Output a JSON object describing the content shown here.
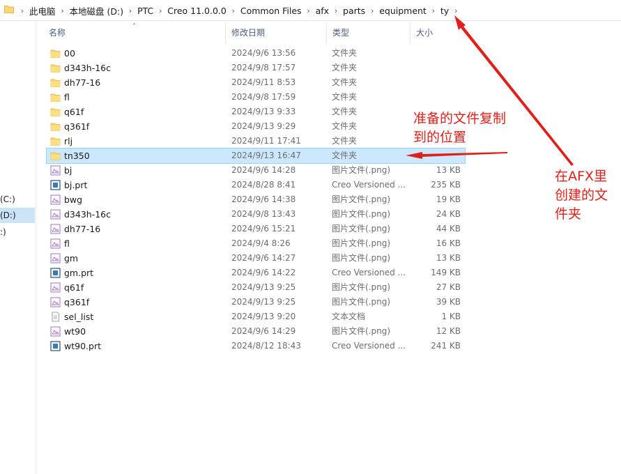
{
  "breadcrumbs": [
    "此电脑",
    "本地磁盘 (D:)",
    "PTC",
    "Creo 11.0.0.0",
    "Common Files",
    "afx",
    "parts",
    "equipment",
    "ty"
  ],
  "nav": [
    {
      "label": "(C:)",
      "selected": false
    },
    {
      "label": "(D:)",
      "selected": true
    },
    {
      "label": ":)",
      "selected": false
    }
  ],
  "columns": {
    "name": "名称",
    "date": "修改日期",
    "type": "类型",
    "size": "大小"
  },
  "files": [
    {
      "name": "00",
      "date": "2024/9/6 13:56",
      "type": "文件夹",
      "size": "",
      "icon": "folder"
    },
    {
      "name": "d343h-16c",
      "date": "2024/9/8 17:57",
      "type": "文件夹",
      "size": "",
      "icon": "folder"
    },
    {
      "name": "dh77-16",
      "date": "2024/9/11 8:53",
      "type": "文件夹",
      "size": "",
      "icon": "folder"
    },
    {
      "name": "fl",
      "date": "2024/9/8 17:59",
      "type": "文件夹",
      "size": "",
      "icon": "folder"
    },
    {
      "name": "q61f",
      "date": "2024/9/13 9:33",
      "type": "文件夹",
      "size": "",
      "icon": "folder"
    },
    {
      "name": "q361f",
      "date": "2024/9/13 9:29",
      "type": "文件夹",
      "size": "",
      "icon": "folder"
    },
    {
      "name": "rlj",
      "date": "2024/9/11 17:41",
      "type": "文件夹",
      "size": "",
      "icon": "folder"
    },
    {
      "name": "tn350",
      "date": "2024/9/13 16:47",
      "type": "文件夹",
      "size": "",
      "icon": "folder",
      "selected": true
    },
    {
      "name": "bj",
      "date": "2024/9/6 14:28",
      "type": "图片文件(.png)",
      "size": "13 KB",
      "icon": "image"
    },
    {
      "name": "bj.prt",
      "date": "2024/8/28 8:41",
      "type": "Creo Versioned ...",
      "size": "235 KB",
      "icon": "creo"
    },
    {
      "name": "bwg",
      "date": "2024/9/6 14:38",
      "type": "图片文件(.png)",
      "size": "19 KB",
      "icon": "image"
    },
    {
      "name": "d343h-16c",
      "date": "2024/9/8 13:43",
      "type": "图片文件(.png)",
      "size": "24 KB",
      "icon": "image"
    },
    {
      "name": "dh77-16",
      "date": "2024/9/6 15:21",
      "type": "图片文件(.png)",
      "size": "44 KB",
      "icon": "image"
    },
    {
      "name": "fl",
      "date": "2024/9/4 8:26",
      "type": "图片文件(.png)",
      "size": "16 KB",
      "icon": "image"
    },
    {
      "name": "gm",
      "date": "2024/9/6 14:27",
      "type": "图片文件(.png)",
      "size": "13 KB",
      "icon": "image"
    },
    {
      "name": "gm.prt",
      "date": "2024/9/6 14:22",
      "type": "Creo Versioned ...",
      "size": "149 KB",
      "icon": "creo"
    },
    {
      "name": "q61f",
      "date": "2024/9/13 9:25",
      "type": "图片文件(.png)",
      "size": "27 KB",
      "icon": "image"
    },
    {
      "name": "q361f",
      "date": "2024/9/13 9:25",
      "type": "图片文件(.png)",
      "size": "39 KB",
      "icon": "image"
    },
    {
      "name": "sel_list",
      "date": "2024/9/13 9:20",
      "type": "文本文档",
      "size": "1 KB",
      "icon": "text"
    },
    {
      "name": "wt90",
      "date": "2024/9/6 14:29",
      "type": "图片文件(.png)",
      "size": "12 KB",
      "icon": "image"
    },
    {
      "name": "wt90.prt",
      "date": "2024/8/12 18:43",
      "type": "Creo Versioned ...",
      "size": "241 KB",
      "icon": "creo"
    }
  ],
  "annotations": {
    "target_lines": [
      "准备的文件复制",
      "到的位置"
    ],
    "folder_lines": [
      "在AFX里",
      "创建的文",
      "件夹"
    ]
  },
  "colors": {
    "annotation": "#e0201a",
    "selection": "#cce8ff",
    "folder": "#f8d775"
  }
}
